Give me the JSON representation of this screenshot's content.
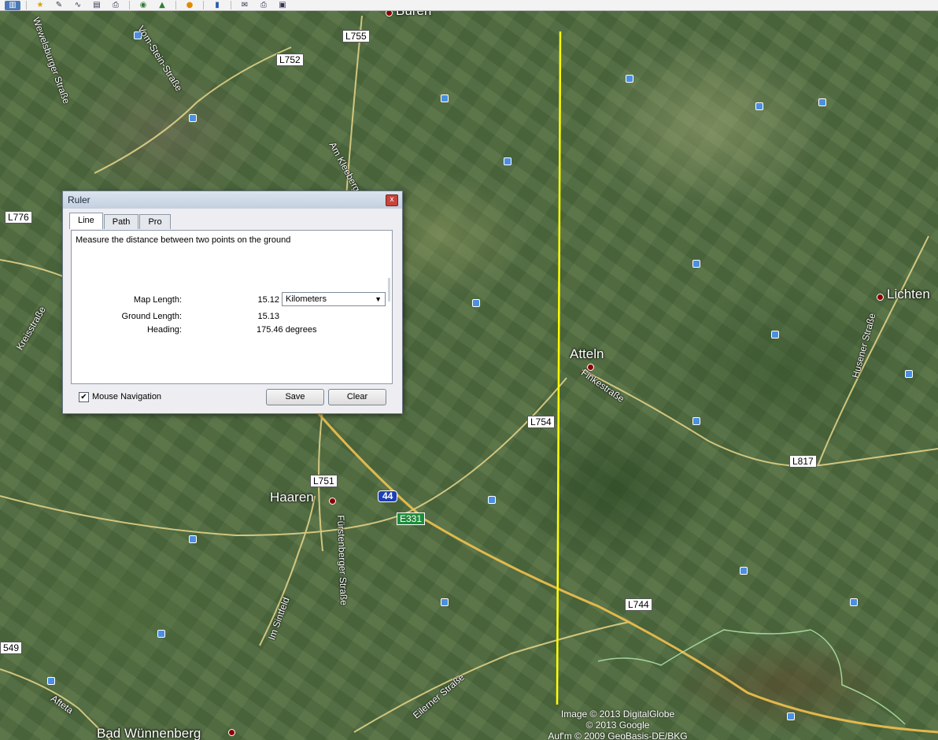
{
  "toolbar": {
    "icons": [
      "sidebar-icon",
      "star-icon",
      "pencil-icon",
      "path-icon",
      "overlay-icon",
      "print-icon",
      "globe-icon",
      "photo-icon",
      "planet-icon",
      "ruler-icon",
      "email-icon",
      "printer-icon",
      "image-icon"
    ]
  },
  "map": {
    "places": [
      {
        "name": "Atteln"
      },
      {
        "name": "Haaren"
      },
      {
        "name": "Bad Wünnenberg"
      },
      {
        "name": "Lichten"
      },
      {
        "name": "Büren"
      }
    ],
    "road_shields": [
      "L755",
      "L752",
      "L776",
      "L754",
      "L751",
      "L817",
      "L744",
      "549"
    ],
    "autobahn": "44",
    "euroroute": "E331",
    "street_names": [
      "Wewelsburger Straße",
      "Vom-Stein-Straße",
      "Am Kleeberg",
      "Kreisstraße",
      "Finkestraße",
      "Fürstenberger Straße",
      "Im Sintfeld",
      "Eilerner Straße",
      "Afteta",
      "Husener Straße",
      "Auf'm"
    ],
    "copyright": {
      "line1": "Image © 2013 DigitalGlobe",
      "line2": "© 2013 Google",
      "line3": "Auf'm © 2009 GeoBasis-DE/BKG"
    },
    "ruler_line_color": "#ffff00"
  },
  "dialog": {
    "title": "Ruler",
    "close": "x",
    "tabs": [
      "Line",
      "Path",
      "Pro"
    ],
    "description": "Measure the distance between two points on the ground",
    "map_length_label": "Map Length:",
    "map_length_value": "15.12",
    "unit": "Kilometers",
    "ground_length_label": "Ground Length:",
    "ground_length_value": "15.13",
    "heading_label": "Heading:",
    "heading_value": "175.46 degrees",
    "mouse_navigation_label": "Mouse Navigation",
    "mouse_navigation_checked": true,
    "save_label": "Save",
    "clear_label": "Clear"
  }
}
